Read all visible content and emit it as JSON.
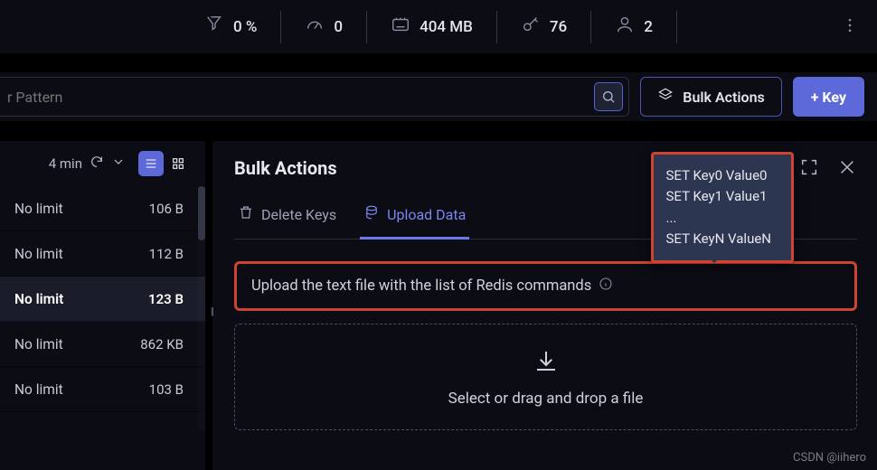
{
  "statusbar": {
    "cpu": "0 %",
    "throughput": "0",
    "memory": "404 MB",
    "keys": "76",
    "clients": "2"
  },
  "toolbar": {
    "search_placeholder": "r Pattern",
    "bulk_label": "Bulk Actions",
    "add_key_label": "+ Key"
  },
  "sidebar": {
    "refresh_label": "4 min",
    "items": [
      {
        "ttl": "No limit",
        "size": "106 B",
        "selected": false
      },
      {
        "ttl": "No limit",
        "size": "112 B",
        "selected": false
      },
      {
        "ttl": "No limit",
        "size": "123 B",
        "selected": true
      },
      {
        "ttl": "No limit",
        "size": "862 KB",
        "selected": false
      },
      {
        "ttl": "No limit",
        "size": "103 B",
        "selected": false
      }
    ]
  },
  "main": {
    "title": "Bulk Actions",
    "tabs": {
      "delete": "Delete Keys",
      "upload": "Upload Data"
    },
    "upload_hint": "Upload the text file with the list of Redis commands",
    "dropzone": "Select or drag and drop a file",
    "tooltip": "SET Key0 Value0\nSET Key1 Value1\n...\nSET KeyN ValueN"
  },
  "watermark": "CSDN @iihero"
}
